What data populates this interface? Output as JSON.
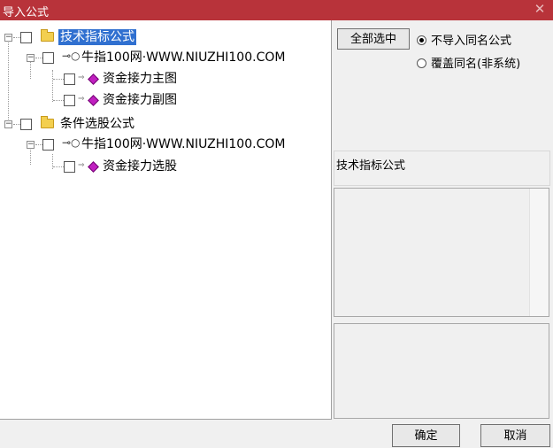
{
  "window": {
    "title": "导入公式",
    "close_glyph": "✕"
  },
  "tree": {
    "groups": [
      {
        "label": "技术指标公式",
        "site_label": "牛指100网·WWW.NIUZHI100.COM",
        "items": [
          "资金接力主图",
          "资金接力副图"
        ]
      },
      {
        "label": "条件选股公式",
        "site_label": "牛指100网·WWW.NIUZHI100.COM",
        "items": [
          "资金接力选股"
        ]
      }
    ]
  },
  "options": {
    "select_all_label": "全部选中",
    "radio_no_import_same": "不导入同名公式",
    "radio_overwrite_same": "覆盖同名(非系统)"
  },
  "info": {
    "selected_name": "技术指标公式"
  },
  "buttons": {
    "ok_label": "确定",
    "cancel_label": "取消"
  },
  "colors": {
    "titlebar": "#b8333a",
    "selection": "#3070d0"
  }
}
